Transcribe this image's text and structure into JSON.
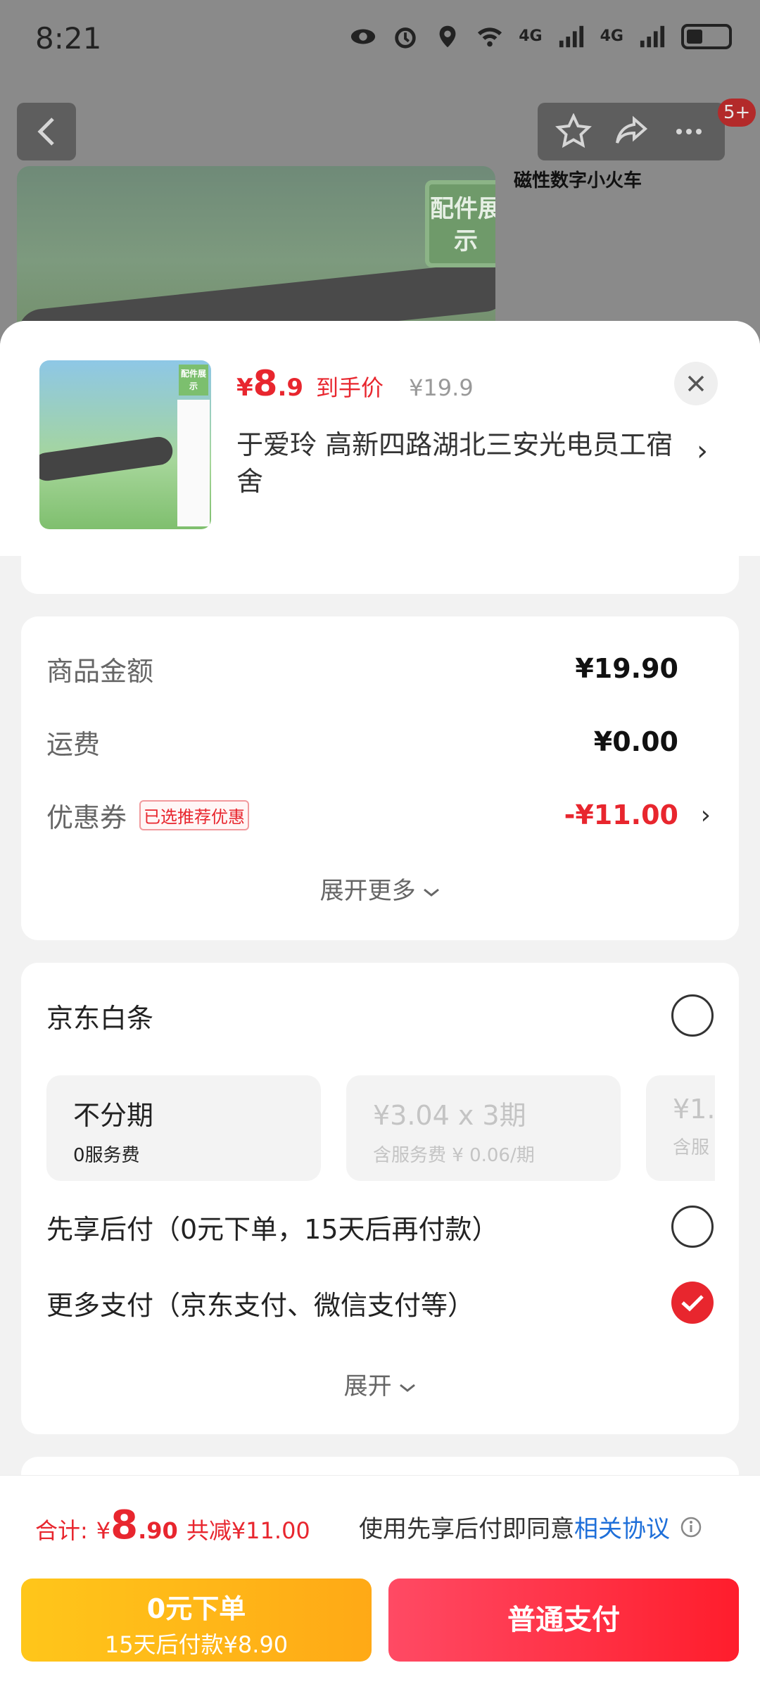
{
  "status_bar": {
    "time": "8:21",
    "icons": [
      "eye-icon",
      "alarm-icon",
      "location-icon",
      "wifi-icon",
      "signal-4g-icon",
      "signal-4g-icon",
      "battery-icon"
    ],
    "net_label_1": "4G",
    "net_label_2": "4G"
  },
  "header": {
    "badge": "5+",
    "icons": [
      "back-icon",
      "star-icon",
      "share-icon",
      "more-icon"
    ]
  },
  "background": {
    "image_tag": "配件展示",
    "side_title": "磁性数字小火车"
  },
  "sheet": {
    "thumb_tag": "配件展示",
    "price": {
      "symbol": "¥",
      "integer": "8",
      "decimal": ".9",
      "tag": "到手价",
      "original": "¥19.9"
    },
    "address": "于爱玲  高新四路湖北三安光电员工宿舍"
  },
  "amount": {
    "goods_label": "商品金额",
    "goods_value": "¥19.90",
    "shipping_label": "运费",
    "shipping_value": "¥0.00",
    "coupon_label": "优惠券",
    "coupon_badge": "已选推荐优惠",
    "coupon_value": "-¥11.00",
    "expand_more": "展开更多"
  },
  "payment": {
    "baitiao_label": "京东白条",
    "plans": [
      {
        "title": "不分期",
        "sub": "0服务费"
      },
      {
        "title": "¥3.04 x 3期",
        "sub": "含服务费 ¥ 0.06/期"
      },
      {
        "title": "¥1.",
        "sub": "含服"
      }
    ],
    "paylater_label": "先享后付（0元下单，15天后再付款）",
    "more_label": "更多支付（京东支付、微信支付等）",
    "more_selected": true,
    "expand": "展开"
  },
  "bottom": {
    "total_label": "合计:",
    "total_symbol": "¥",
    "total_integer": "8",
    "total_decimal": ".90",
    "total_save": "共减¥11.00",
    "agree_text": "使用先享后付即同意",
    "agree_link": "相关协议",
    "zero_title": "0元下单",
    "zero_sub": "15天后付款¥8.90",
    "normal_pay": "普通支付"
  },
  "colors": {
    "accent": "#e8262e",
    "link": "#1e6fd9",
    "yellow_button": "#ffb218",
    "red_button": "#ff2a3e"
  }
}
